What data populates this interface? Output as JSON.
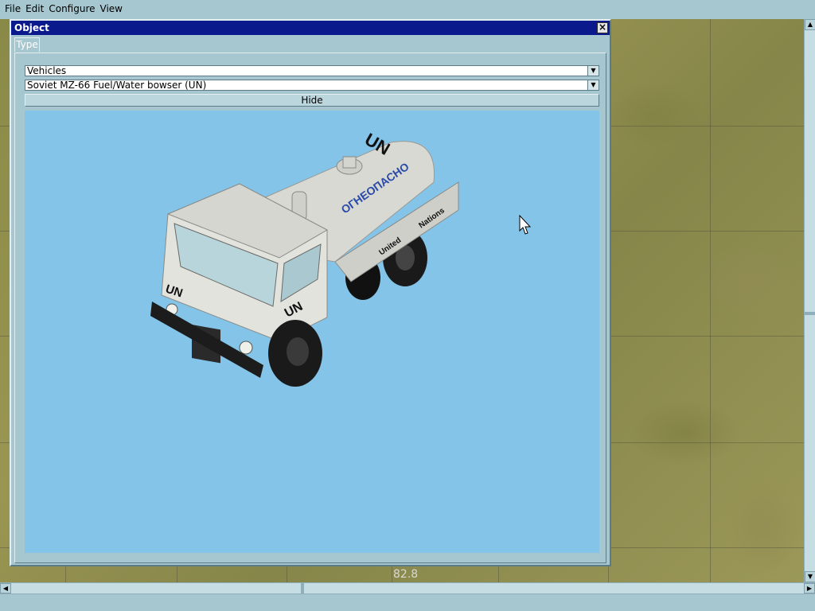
{
  "menubar": {
    "items": [
      "File",
      "Edit",
      "Configure",
      "View"
    ]
  },
  "object_window": {
    "title": "Object",
    "tabs": [
      "Type"
    ],
    "category_select": {
      "value": "Vehicles"
    },
    "object_select": {
      "value": "Soviet MZ-66 Fuel/Water bowser (UN)"
    },
    "hide_button": "Hide",
    "preview": {
      "background_color": "#84c4e8",
      "markings": [
        "UN",
        "ОГНЕОПАСНО",
        "United",
        "Nations"
      ]
    }
  },
  "map": {
    "coordinate_readout": "82.8"
  },
  "icons": {
    "close": "close-icon",
    "dropdown": "chevron-down-icon",
    "cursor": "mouse-pointer-icon"
  },
  "colors": {
    "titlebar": "#0a1a8c",
    "chrome": "#a6c7d0"
  }
}
